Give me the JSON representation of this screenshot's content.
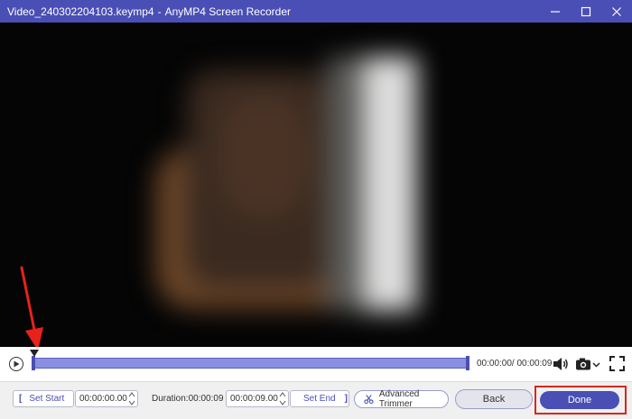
{
  "window": {
    "file_name": "Video_240302204103.keymp4",
    "separator": "-",
    "app_name": "AnyMP4 Screen Recorder",
    "accent_color": "#4a4fb5"
  },
  "player": {
    "time_display": "00:00:00/ 00:00:09",
    "progress": 0
  },
  "trim": {
    "set_start_label": "Set Start",
    "start_time": "00:00:00.00",
    "duration_text": "Duration:00:00:09",
    "end_time": "00:00:09.00",
    "set_end_label": "Set End",
    "bracket_open": "[",
    "bracket_close": "]"
  },
  "buttons": {
    "advanced_trimmer": "Advanced Trimmer",
    "back": "Back",
    "done": "Done"
  },
  "icons": {
    "minimize": "minimize-icon",
    "maximize": "maximize-icon",
    "close": "close-icon",
    "play": "play-icon",
    "volume": "volume-icon",
    "camera": "camera-icon",
    "fullscreen": "fullscreen-icon",
    "trimmer": "trimmer-icon"
  },
  "annotation": {
    "arrow_color": "#e8211b",
    "highlight_color": "#d9261c"
  }
}
